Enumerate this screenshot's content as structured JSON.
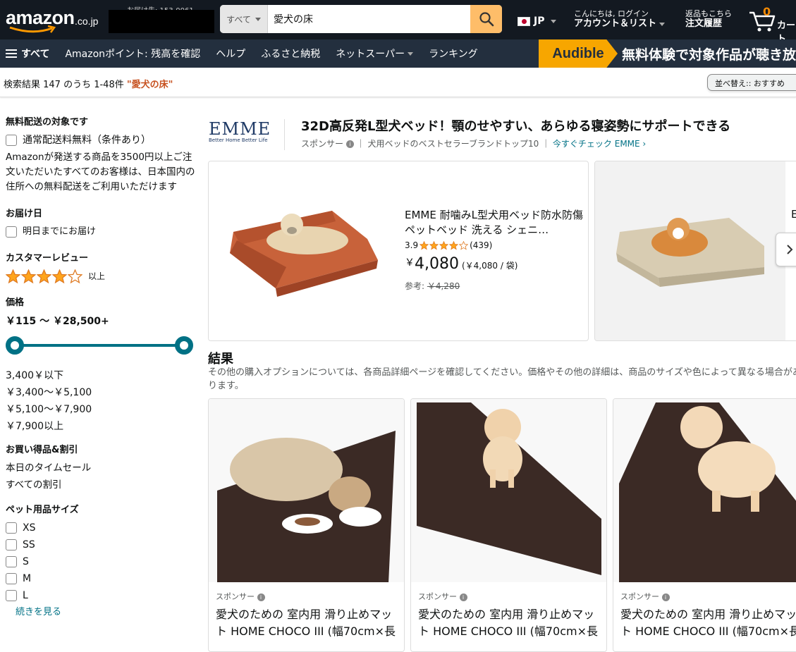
{
  "header": {
    "logo_text": "amazon",
    "logo_suffix": ".co.jp",
    "deliver_to": "お届け先: 153-0061",
    "search_category": "すべて",
    "search_value": "愛犬の床",
    "lang": "JP",
    "account_line1": "こんにちは, ログイン",
    "account_line2": "アカウント＆リスト",
    "orders_line1": "返品もこちら",
    "orders_line2": "注文履歴",
    "cart_count": "0",
    "cart_label": "カート"
  },
  "nav": {
    "all": "すべて",
    "items": [
      "Amazonポイント: 残高を確認",
      "ヘルプ",
      "ふるさと納税",
      "ネットスーパー",
      "ランキング"
    ],
    "audible_badge": "Audible",
    "audible_text": "無料体験で対象作品が聴き放"
  },
  "results_bar": {
    "text": "検索結果 147 のうち 1-48件 ",
    "query": "\"愛犬の床\"",
    "sort_label": "並べ替え:: おすすめ"
  },
  "sidebar": {
    "free_shipping_title": "無料配送の対象です",
    "free_shipping_option": "通常配送料無料（条件あり）",
    "free_shipping_desc": "Amazonが発送する商品を3500円以上ご注文いただいたすべてのお客様は、日本国内の住所への無料配送をご利用いただけます",
    "delivery_title": "お届け日",
    "delivery_option": "明日までにお届け",
    "review_title": "カスタマーレビュー",
    "review_suffix": "以上",
    "review_stars": 4,
    "price_title": "価格",
    "price_range": "￥115 〜 ￥28,500+",
    "price_options": [
      "3,400￥以下",
      "￥3,400〜￥5,100",
      "￥5,100〜￥7,900",
      "￥7,900以上"
    ],
    "deals_title": "お買い得品&割引",
    "deals_options": [
      "本日のタイムセール",
      "すべての割引"
    ],
    "size_title": "ペット用品サイズ",
    "size_options": [
      "XS",
      "SS",
      "S",
      "M",
      "L"
    ],
    "more_link": "続きを見る"
  },
  "brand": {
    "logo": "EMME",
    "logo_tag": "Better Home Better Life",
    "title": "32D高反発L型犬ベッド！顎のせやすい、あらゆる寝姿勢にサポートできる",
    "sponsored": "スポンサー",
    "sub": "｜ 犬用ベッドのベストセラーブランドトップ10 ｜ ",
    "link": "今すぐチェック EMME ›"
  },
  "featured": {
    "title": "EMME 耐噛みL型犬用ベッド防水防傷ペットベッド 洗える シェニ…",
    "rating": "3.9",
    "review_count": "(439)",
    "stars": 3.9,
    "price_symbol": "￥",
    "price": "4,080",
    "unit_price": "(￥4,080 / 袋)",
    "ref_label": "参考: ",
    "ref_price": "￥4,280",
    "card2_title": "E"
  },
  "results": {
    "heading": "結果",
    "subtext": "その他の購入オプションについては、各商品詳細ページを確認してください。価格やその他の詳細は、商品のサイズや色によって異なる場合があります。",
    "products": [
      {
        "sponsored": "スポンサー",
        "title": "愛犬のための 室内用 滑り止めマット HOME CHOCO III (幅70cm×長"
      },
      {
        "sponsored": "スポンサー",
        "title": "愛犬のための 室内用 滑り止めマット HOME CHOCO III (幅70cm×長"
      },
      {
        "sponsored": "スポンサー",
        "title": "愛犬のための 室内用 滑り止めマット HOME CHOCO III (幅70cm×長"
      }
    ]
  },
  "colors": {
    "header_bg": "#131921",
    "nav_bg": "#232f3e",
    "search_button": "#febd69",
    "accent_teal": "#007185",
    "query_orange": "#c7511f",
    "star": "#ffa41c"
  }
}
